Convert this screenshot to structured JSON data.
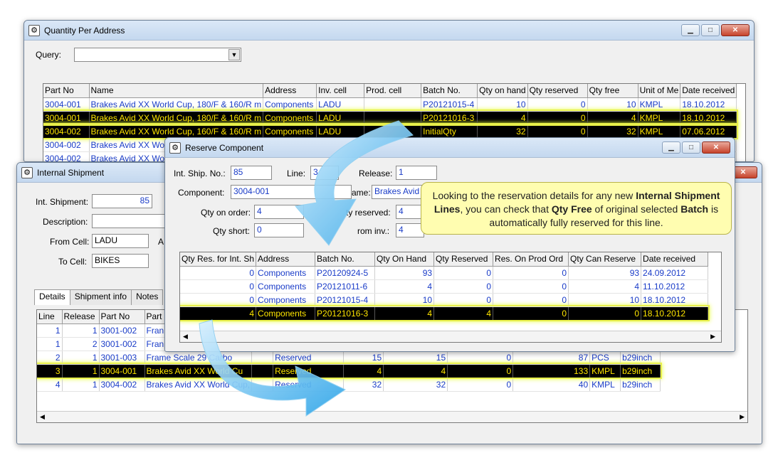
{
  "qpa": {
    "title": "Quantity Per Address",
    "query_label": "Query:",
    "query_value": "",
    "columns": [
      "Part No",
      "Name",
      "Address",
      "Inv. cell",
      "Prod. cell",
      "Batch No.",
      "Qty on hand",
      "Qty reserved",
      "Qty free",
      "Unit of Me",
      "Date received"
    ],
    "rows": [
      {
        "part": "3004-001",
        "name": "Brakes Avid XX World Cup, 180/F & 160/R m",
        "address": "Components",
        "inv": "LADU",
        "prod": "",
        "batch": "P20121015-4",
        "onhand": "10",
        "reserved": "0",
        "free": "10",
        "unit": "KMPL",
        "date": "18.10.2012"
      },
      {
        "part": "3004-001",
        "name": "Brakes Avid XX World Cup, 180/F & 160/R m",
        "address": "Components",
        "inv": "LADU",
        "prod": "",
        "batch": "P20121016-3",
        "onhand": "4",
        "reserved": "0",
        "free": "4",
        "unit": "KMPL",
        "date": "18.10.2012"
      },
      {
        "part": "3004-002",
        "name": "Brakes Avid XX World Cup, 160/F & 160/R m",
        "address": "Components",
        "inv": "LADU",
        "prod": "",
        "batch": "InitialQty",
        "onhand": "32",
        "reserved": "0",
        "free": "32",
        "unit": "KMPL",
        "date": "07.06.2012"
      },
      {
        "part": "3004-002",
        "name": "Brakes Avid XX Wo",
        "address": "",
        "inv": "",
        "prod": "",
        "batch": "",
        "onhand": "",
        "reserved": "",
        "free": "",
        "unit": "",
        "date": ""
      },
      {
        "part": "3004-002",
        "name": "Brakes Avid XX Wo",
        "address": "",
        "inv": "",
        "prod": "",
        "batch": "",
        "onhand": "",
        "reserved": "",
        "free": "",
        "unit": "",
        "date": ""
      }
    ]
  },
  "ish": {
    "title": "Internal Shipment",
    "int_shipment_label": "Int. Shipment:",
    "int_shipment_value": "85",
    "description_label": "Description:",
    "description_value": "",
    "from_cell_label": "From Cell:",
    "from_cell_value": "LADU",
    "to_cell_label": "To Cell:",
    "to_cell_value": "BIKES",
    "partial_label": "A",
    "tabs": [
      "Details",
      "Shipment info",
      "Notes"
    ],
    "columns": [
      "Line",
      "Release",
      "Part No",
      "Part"
    ],
    "rows": [
      {
        "line": "1",
        "release": "1",
        "part": "3001-002",
        "name": "Fran",
        "status": "",
        "qty1": "",
        "qty2": "",
        "qty3": "",
        "qty4": "",
        "unit": "",
        "cell": ""
      },
      {
        "line": "1",
        "release": "2",
        "part": "3001-002",
        "name": "Fran",
        "status": "",
        "qty1": "",
        "qty2": "",
        "qty3": "",
        "qty4": "",
        "unit": "",
        "cell": ""
      },
      {
        "line": "2",
        "release": "1",
        "part": "3001-003",
        "name": "Frame Scale 29 Carbo",
        "status": "Reserved",
        "qty1": "15",
        "qty2": "15",
        "qty3": "0",
        "qty4": "87",
        "unit": "PCS",
        "cell": "b29inch"
      },
      {
        "line": "3",
        "release": "1",
        "part": "3004-001",
        "name": "Brakes Avid XX World Cu",
        "status": "Reserved",
        "qty1": "4",
        "qty2": "4",
        "qty3": "0",
        "qty4": "133",
        "unit": "KMPL",
        "cell": "b29inch"
      },
      {
        "line": "4",
        "release": "1",
        "part": "3004-002",
        "name": "Brakes Avid XX World Cup,",
        "status": "Reserved",
        "qty1": "32",
        "qty2": "32",
        "qty3": "0",
        "qty4": "40",
        "unit": "KMPL",
        "cell": "b29inch"
      }
    ]
  },
  "rc": {
    "title": "Reserve Component",
    "int_ship_no_label": "Int. Ship. No.:",
    "int_ship_no_value": "85",
    "line_label": "Line:",
    "line_value": "3",
    "release_label": "Release:",
    "release_value": "1",
    "component_label": "Component:",
    "component_value": "3004-001",
    "name_label": "ame:",
    "name_value": "Brakes Avid",
    "qty_on_order_label": "Qty on order:",
    "qty_on_order_value": "4",
    "qty_reserved_label": "ty reserved:",
    "qty_reserved_value": "4",
    "qty_short_label": "Qty short:",
    "qty_short_value": "0",
    "from_inv_label": "rom inv.:",
    "from_inv_value": "4",
    "columns": [
      "Qty Res. for Int. Sh",
      "Address",
      "Batch No.",
      "Qty On Hand",
      "Qty Reserved",
      "Res. On Prod Ord",
      "Qty Can Reserve",
      "Date received"
    ],
    "rows": [
      {
        "res": "0",
        "address": "Components",
        "batch": "P20120924-5",
        "onhand": "93",
        "reserved": "0",
        "prod": "0",
        "can": "93",
        "date": "24.09.2012"
      },
      {
        "res": "0",
        "address": "Components",
        "batch": "P20121011-6",
        "onhand": "4",
        "reserved": "0",
        "prod": "0",
        "can": "4",
        "date": "11.10.2012"
      },
      {
        "res": "0",
        "address": "Components",
        "batch": "P20121015-4",
        "onhand": "10",
        "reserved": "0",
        "prod": "0",
        "can": "10",
        "date": "18.10.2012"
      },
      {
        "res": "4",
        "address": "Components",
        "batch": "P20121016-3",
        "onhand": "4",
        "reserved": "4",
        "prod": "0",
        "can": "0",
        "date": "18.10.2012"
      }
    ]
  },
  "callout": {
    "t1": "Looking to the reservation details for any new ",
    "b1": "Internal Shipment Lines",
    "t2": ", you can check that ",
    "b2": "Qty Free",
    "t3": " of original selected ",
    "b3": "Batch",
    "t4": " is automatically fully reserved for this line."
  },
  "icons": {
    "window": "window-icon",
    "minimize": "minimize-icon",
    "maximize": "maximize-icon",
    "close": "close-icon"
  },
  "colors": {
    "selection_bg": "#000000",
    "selection_text": "#ffe600",
    "highlight": "#e8f04a",
    "value_text": "#1a3cc8",
    "arrow": "#2aa3e8",
    "callout_bg": "#fffdb0"
  }
}
